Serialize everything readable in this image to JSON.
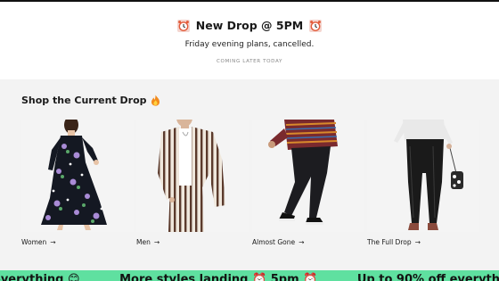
{
  "promo": {
    "title": "New Drop @ 5PM",
    "subtitle": "Friday evening plans, cancelled.",
    "note": "COMING LATER TODAY",
    "icon": "alarm-clock-icon"
  },
  "section": {
    "title": "Shop the Current Drop",
    "icon": "fire-icon"
  },
  "cards": [
    {
      "label": "Women",
      "arrow": "→"
    },
    {
      "label": "Men",
      "arrow": "→"
    },
    {
      "label": "Almost Gone",
      "arrow": "→"
    },
    {
      "label": "The Full Drop",
      "arrow": "→"
    }
  ],
  "ticker": {
    "items": [
      "everything 😊",
      "More styles landing ⏰ 5pm ⏰",
      "Up to 90% off everything"
    ]
  },
  "colors": {
    "promo_bg": "#ffffff",
    "page_bg": "#f3f3f3",
    "ticker_bg": "#5fe0a0",
    "text": "#1a1a1a"
  }
}
